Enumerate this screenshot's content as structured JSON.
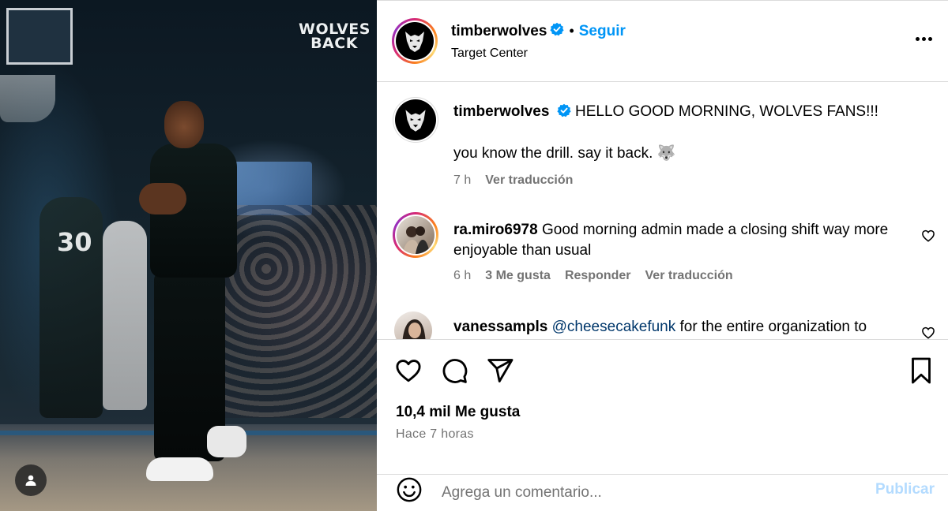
{
  "photo": {
    "watermark_line1": "WOLVES",
    "watermark_line2": "BACK",
    "jersey_number": "30"
  },
  "header": {
    "username": "timberwolves",
    "separator": "•",
    "follow_label": "Seguir",
    "location": "Target Center"
  },
  "caption": {
    "username": "timberwolves",
    "text_line1": "HELLO GOOD MORNING, WOLVES FANS!!!",
    "text_line2": "you know the drill. say it back. 🐺",
    "time": "7 h",
    "translate": "Ver traducción"
  },
  "comments": [
    {
      "username": "ra.miro6978",
      "text": "Good morning admin made a closing shift way more enjoyable than usual",
      "time": "6 h",
      "likes": "3 Me gusta",
      "reply": "Responder",
      "translate": "Ver traducción"
    },
    {
      "username": "vanessampls",
      "mention": "@cheesecakefunk",
      "text": "for the entire organization to"
    }
  ],
  "actions": {
    "likes_count": "10,4 mil Me gusta",
    "time_ago": "Hace 7 horas"
  },
  "comment_box": {
    "placeholder": "Agrega un comentario...",
    "post_label": "Publicar"
  },
  "colors": {
    "accent": "#0095f6",
    "mention": "#00376b",
    "muted": "#737373",
    "post_disabled": "#b3dbff"
  }
}
